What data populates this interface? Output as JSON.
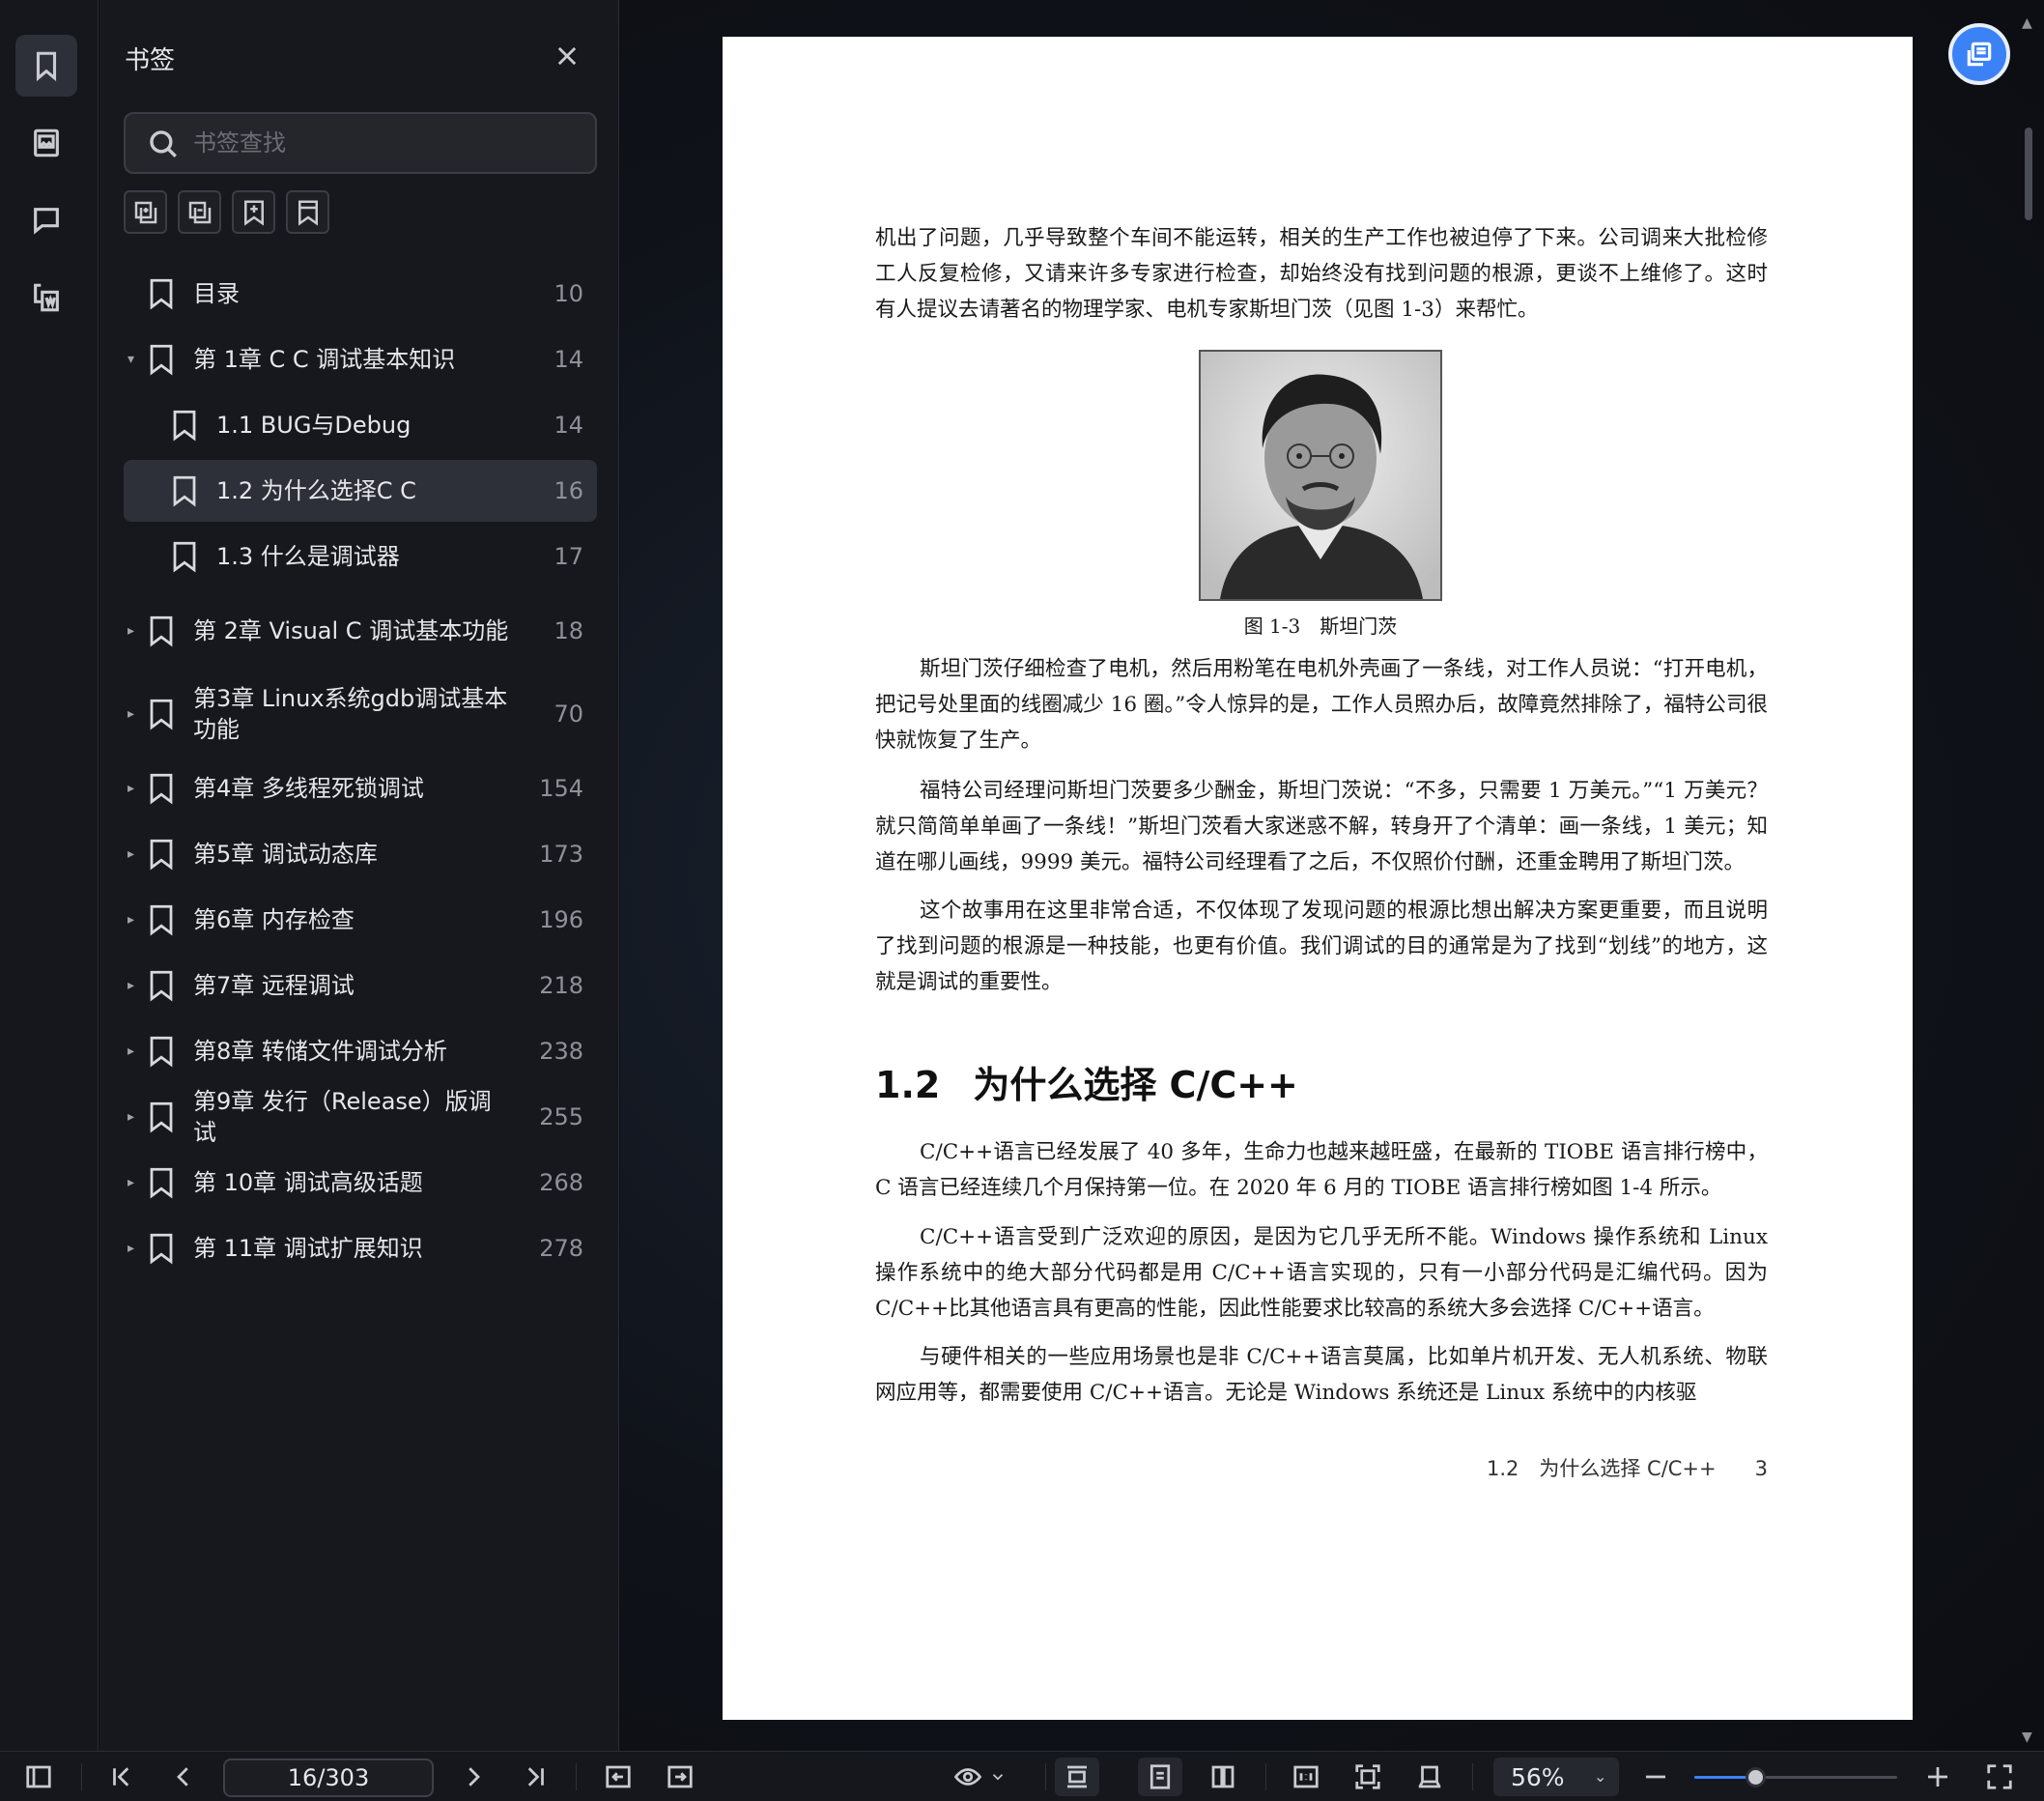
{
  "panel": {
    "title": "书签",
    "search_placeholder": "书签查找"
  },
  "bookmarks": [
    {
      "label": "目录",
      "page": "10",
      "level": 0,
      "caret": ""
    },
    {
      "label": "第 1章 C C 调试基本知识",
      "page": "14",
      "level": 0,
      "caret": "▾"
    },
    {
      "label": "1.1 BUG与Debug",
      "page": "14",
      "level": 1,
      "caret": ""
    },
    {
      "label": "1.2 为什么选择C C",
      "page": "16",
      "level": 1,
      "caret": "",
      "selected": true
    },
    {
      "label": "1.3 什么是调试器",
      "page": "17",
      "level": 1,
      "caret": ""
    },
    {
      "label": "第 2章 Visual C 调试基本功能",
      "page": "18",
      "level": 0,
      "caret": "▸"
    },
    {
      "label": "第3章 Linux系统gdb调试基本功能",
      "page": "70",
      "level": 0,
      "caret": "▸"
    },
    {
      "label": "第4章 多线程死锁调试",
      "page": "154",
      "level": 0,
      "caret": "▸"
    },
    {
      "label": "第5章 调试动态库",
      "page": "173",
      "level": 0,
      "caret": "▸"
    },
    {
      "label": "第6章 内存检查",
      "page": "196",
      "level": 0,
      "caret": "▸"
    },
    {
      "label": "第7章 远程调试",
      "page": "218",
      "level": 0,
      "caret": "▸"
    },
    {
      "label": "第8章 转储文件调试分析",
      "page": "238",
      "level": 0,
      "caret": "▸"
    },
    {
      "label": "第9章 发行（Release）版调试",
      "page": "255",
      "level": 0,
      "caret": "▸"
    },
    {
      "label": "第 10章 调试高级话题",
      "page": "268",
      "level": 0,
      "caret": "▸"
    },
    {
      "label": "第 11章 调试扩展知识",
      "page": "278",
      "level": 0,
      "caret": "▸"
    }
  ],
  "document": {
    "p1": "机出了问题，几乎导致整个车间不能运转，相关的生产工作也被迫停了下来。公司调来大批检修工人反复检修，又请来许多专家进行检查，却始终没有找到问题的根源，更谈不上维修了。这时有人提议去请著名的物理学家、电机专家斯坦门茨（见图 1-3）来帮忙。",
    "caption": "图 1-3　斯坦门茨",
    "p2": "斯坦门茨仔细检查了电机，然后用粉笔在电机外壳画了一条线，对工作人员说：“打开电机，把记号处里面的线圈减少 16 圈。”令人惊异的是，工作人员照办后，故障竟然排除了，福特公司很快就恢复了生产。",
    "p3": "福特公司经理问斯坦门茨要多少酬金，斯坦门茨说：“不多，只需要 1 万美元。”“1 万美元？就只简简单单画了一条线！”斯坦门茨看大家迷惑不解，转身开了个清单：画一条线，1 美元；知道在哪儿画线，9999 美元。福特公司经理看了之后，不仅照价付酬，还重金聘用了斯坦门茨。",
    "p4": "这个故事用在这里非常合适，不仅体现了发现问题的根源比想出解决方案更重要，而且说明了找到问题的根源是一种技能，也更有价值。我们调试的目的通常是为了找到“划线”的地方，这就是调试的重要性。",
    "section_num": "1.2",
    "section_title": "为什么选择 C/C++",
    "p5": "C/C++语言已经发展了 40 多年，生命力也越来越旺盛，在最新的 TIOBE 语言排行榜中，C 语言已经连续几个月保持第一位。在 2020 年 6 月的 TIOBE 语言排行榜如图 1-4 所示。",
    "p6": "C/C++语言受到广泛欢迎的原因，是因为它几乎无所不能。Windows 操作系统和 Linux 操作系统中的绝大部分代码都是用 C/C++语言实现的，只有一小部分代码是汇编代码。因为 C/C++比其他语言具有更高的性能，因此性能要求比较高的系统大多会选择 C/C++语言。",
    "p7": "与硬件相关的一些应用场景也是非 C/C++语言莫属，比如单片机开发、无人机系统、物联网应用等，都需要使用 C/C++语言。无论是 Windows 系统还是 Linux 系统中的内核驱",
    "footer_section": "1.2　为什么选择 C/C++",
    "footer_page": "3"
  },
  "toolbar": {
    "page_indicator": "16/303",
    "zoom": "56%",
    "zoom_fraction": 0.3
  }
}
